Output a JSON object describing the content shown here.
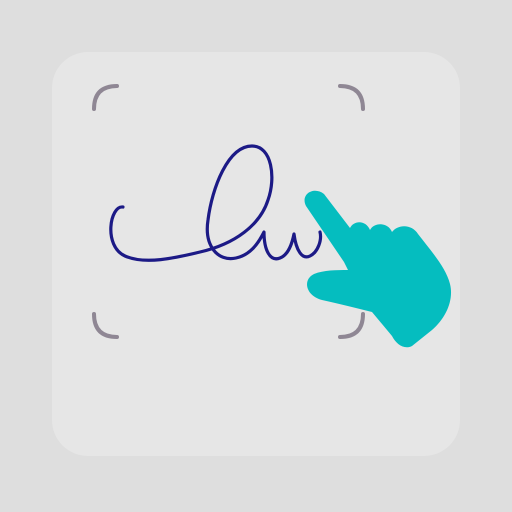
{
  "icon": {
    "name": "signature-touch-icon",
    "colors": {
      "background": "#dedede",
      "tile": "#e6e6e6",
      "frame_corners": "#8f8794",
      "signature_stroke": "#1c1a86",
      "hand": "#05bdbf"
    }
  }
}
